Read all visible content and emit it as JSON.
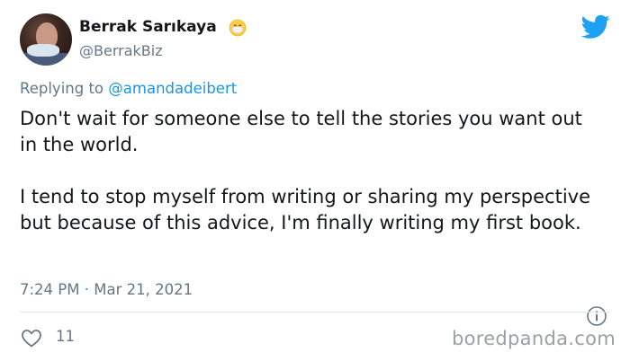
{
  "author": {
    "display_name": "Berrak Sarıkaya",
    "handle": "@BerrakBiz",
    "emoji_icon": "face-with-medical-mask-icon",
    "avatar": "profile-photo"
  },
  "reply": {
    "prefix": "Replying to ",
    "mention": "@amandadeibert"
  },
  "tweet": {
    "paragraphs": [
      "Don't wait for someone else to tell the stories you want out in the world.",
      "I tend to stop myself from writing or sharing my perspective but because of this advice, I'm finally writing my first book."
    ],
    "timestamp": "7:24 PM · Mar 21, 2021"
  },
  "actions": {
    "like_icon": "heart-icon",
    "like_count": "11",
    "info_icon": "info-icon"
  },
  "brand": {
    "logo_icon": "twitter-bird-icon",
    "watermark": "boredpanda.com"
  },
  "colors": {
    "twitter_blue": "#1da1f2",
    "link_blue": "#1b95e0",
    "muted_gray": "#657786",
    "text_dark": "#14171a",
    "divider": "#e1e8ed"
  }
}
